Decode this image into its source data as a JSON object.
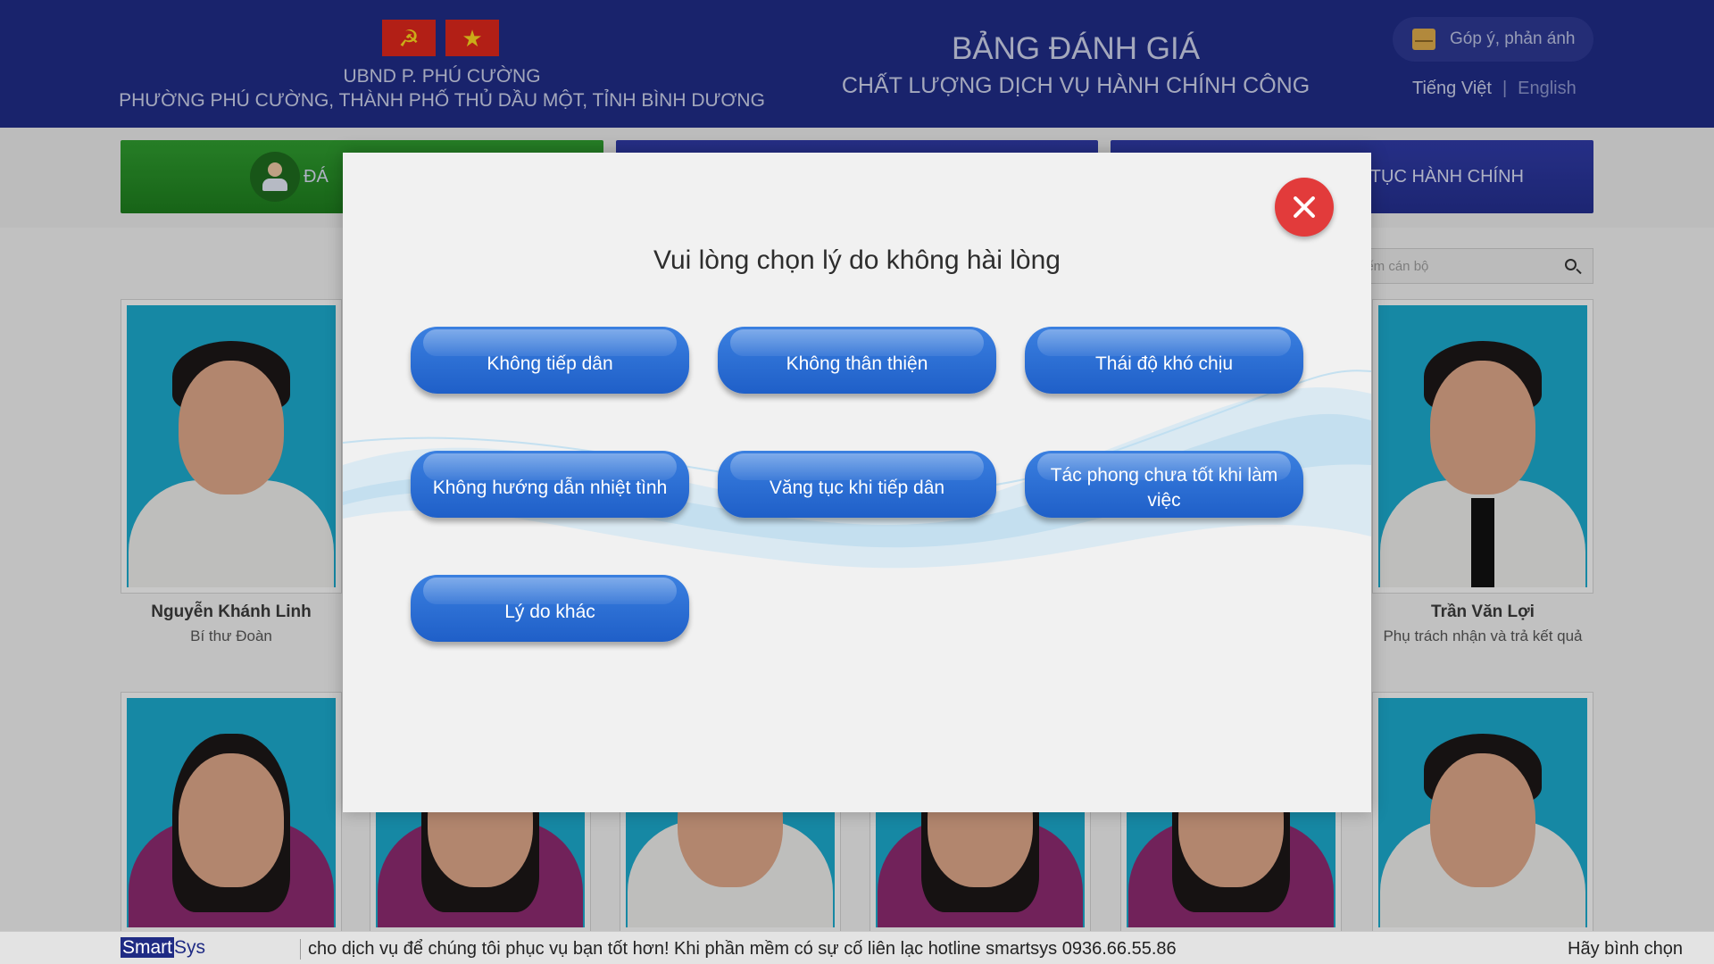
{
  "header": {
    "flags": [
      "☭",
      "★"
    ],
    "org_line1": "UBND P. PHÚ CƯỜNG",
    "org_line2": "PHƯỜNG PHÚ CƯỜNG, THÀNH PHỐ THỦ DẦU MỘT, TỈNH BÌNH DƯƠNG",
    "title": "BẢNG ĐÁNH GIÁ",
    "subtitle": "CHẤT LƯỢNG DỊCH VỤ HÀNH CHÍNH CÔNG",
    "feedback_label": "Góp ý, phản ánh",
    "feedback_icon": "envelope-icon",
    "lang_vi": "Tiếng Việt",
    "lang_sep": "|",
    "lang_en": "English"
  },
  "tabs": {
    "left_label": "ĐÁ",
    "right_label": "TỤC HÀNH CHÍNH"
  },
  "search": {
    "placeholder": "iếm cán bộ"
  },
  "staff": [
    {
      "name": "Nguyễn Khánh Linh",
      "role": "Bí thư Đoàn"
    },
    {
      "name": "Trần Văn Lợi",
      "role": "Phụ trách nhận và trả kết quả"
    }
  ],
  "modal": {
    "title": "Vui lòng chọn lý do không hài lòng",
    "reasons": [
      "Không tiếp dân",
      "Không thân thiện",
      "Thái độ khó chịu",
      "Không hướng dẫn nhiệt tình",
      "Văng tục khi tiếp dân",
      "Tác phong chưa tốt khi làm việc",
      "Lý do khác"
    ]
  },
  "footer": {
    "brand_a": "Smart",
    "brand_b": "Sys",
    "ticker": "cho dịch vụ để chúng tôi phục vụ bạn tốt hơn! Khi phần mềm có sự cố liên lạc hotline smartsys 0936.66.55.86",
    "vote": "Hãy bình chọn"
  },
  "colors": {
    "header_bg": "#1f2b84",
    "tab_green": "#2f9a2f",
    "button_blue": "#1f5fc8",
    "close_red": "#e23b3b",
    "photo_bg": "#1ba6c8"
  }
}
